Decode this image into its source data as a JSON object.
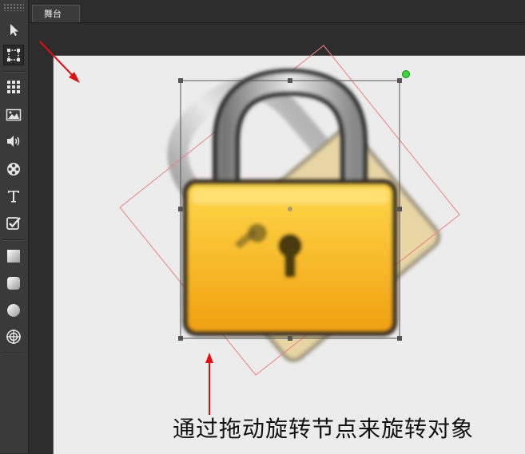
{
  "tab": {
    "label": "舞台"
  },
  "caption": "通过拖动旋转节点来旋转对象",
  "tools": [
    {
      "name": "select-tool",
      "icon": "arrow-pointer-icon"
    },
    {
      "name": "transform-tool",
      "icon": "transform-box-icon",
      "active": true
    },
    {
      "name": "grid-tool",
      "icon": "grid-icon"
    },
    {
      "name": "image-tool",
      "icon": "image-icon"
    },
    {
      "name": "audio-tool",
      "icon": "speaker-icon"
    },
    {
      "name": "video-tool",
      "icon": "film-reel-icon"
    },
    {
      "name": "text-tool",
      "icon": "text-icon"
    },
    {
      "name": "checkbox-tool",
      "icon": "checkbox-icon"
    },
    {
      "name": "rectangle-tool",
      "icon": "rectangle-icon"
    },
    {
      "name": "rounded-rectangle-tool",
      "icon": "rounded-rectangle-icon"
    },
    {
      "name": "circle-tool",
      "icon": "circle-icon"
    },
    {
      "name": "target-tool",
      "icon": "target-icon"
    }
  ],
  "colors": {
    "accent_arrow": "#e01010",
    "rotate_node": "#3cd63c",
    "rotated_outline": "#f08080"
  }
}
